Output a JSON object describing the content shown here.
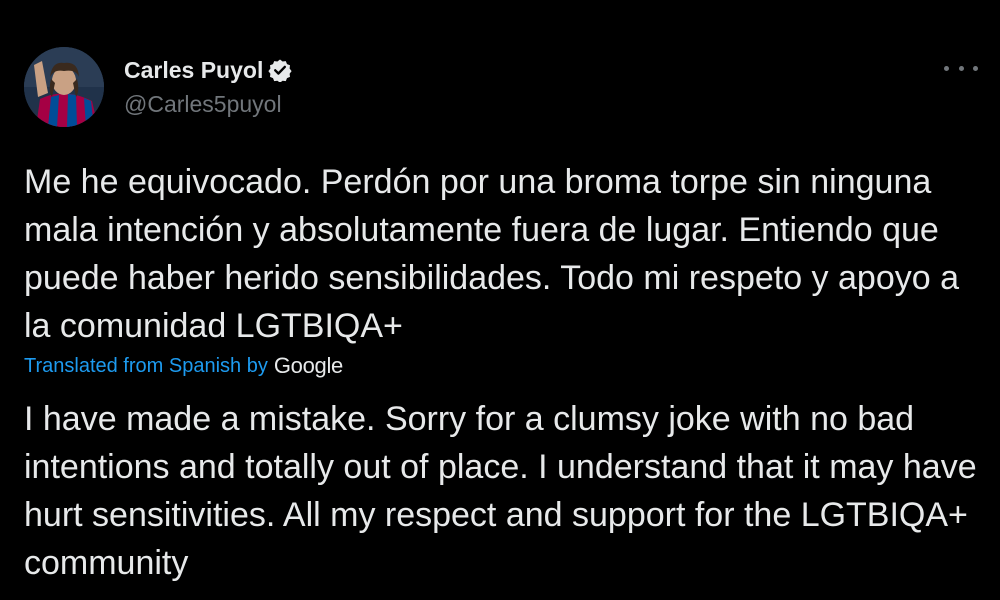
{
  "author": {
    "name": "Carles Puyol",
    "handle": "@Carles5puyol",
    "verified_icon": "verified-badge-icon"
  },
  "tweet": {
    "original_text": "Me he equivocado. Perdón por una broma torpe sin ninguna mala intención y absolutamente fuera de lugar. Entiendo que puede haber herido sensibilidades. Todo mi respeto y apoyo a la comunidad LGTBIQA+",
    "translation_label": "Translated from Spanish by",
    "translation_provider": "Google",
    "translated_text": "I have made a mistake. Sorry for a clumsy joke with no bad intentions and totally out of place. I understand that it may have hurt sensitivities. All my respect and support for the LGTBIQA+ community"
  },
  "icons": {
    "more": "more-options-icon",
    "avatar": "avatar"
  },
  "colors": {
    "background": "#000000",
    "text": "#e7e9ea",
    "secondary_text": "#71767b",
    "link": "#1d9bf0"
  }
}
